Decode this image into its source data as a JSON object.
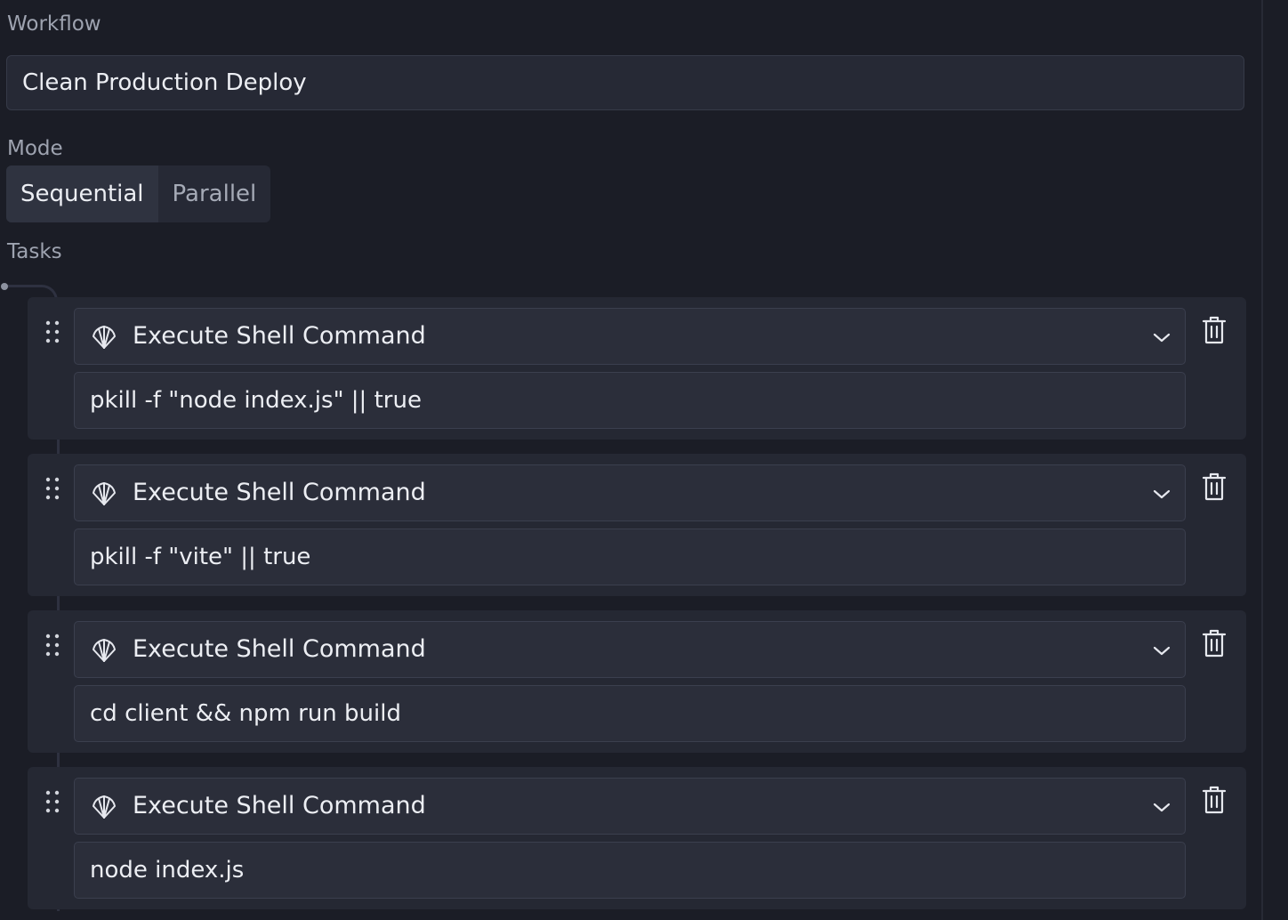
{
  "workflow": {
    "label": "Workflow",
    "name_value": "Clean Production Deploy"
  },
  "mode": {
    "label": "Mode",
    "options": [
      "Sequential",
      "Parallel"
    ],
    "selected": "Sequential"
  },
  "tasks": {
    "label": "Tasks",
    "items": [
      {
        "action": "Execute Shell Command",
        "action_icon": "shell-icon",
        "command": "pkill -f \"node index.js\" || true"
      },
      {
        "action": "Execute Shell Command",
        "action_icon": "shell-icon",
        "command": "pkill -f \"vite\" || true"
      },
      {
        "action": "Execute Shell Command",
        "action_icon": "shell-icon",
        "command": "cd client && npm run build"
      },
      {
        "action": "Execute Shell Command",
        "action_icon": "shell-icon",
        "command": "node index.js"
      }
    ]
  },
  "icons": {
    "drag": "drag-handle-icon",
    "dropdown": "chevron-down-icon",
    "delete": "trash-icon"
  },
  "colors": {
    "background": "#1b1d26",
    "card": "#252833",
    "input": "#2b2e3a",
    "border": "#3b3f4e",
    "text": "#eceef3",
    "muted_text": "#9ea3b0"
  }
}
